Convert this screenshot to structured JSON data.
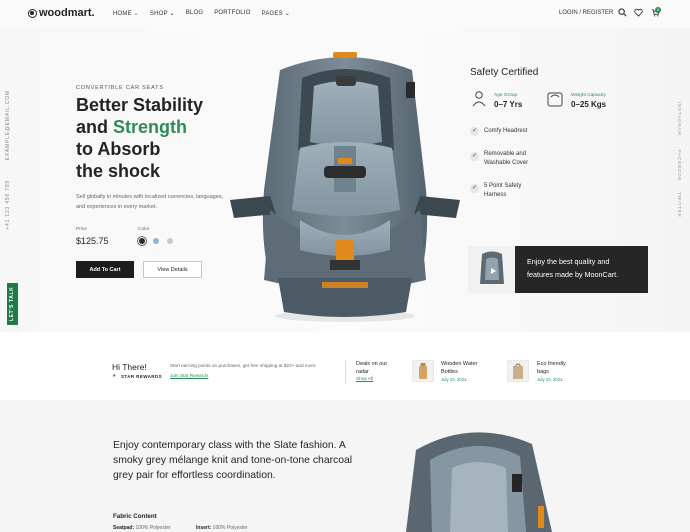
{
  "header": {
    "logo": "woodmart.",
    "nav": [
      {
        "label": "HOME",
        "active": true,
        "dropdown": true
      },
      {
        "label": "SHOP",
        "active": false,
        "dropdown": true
      },
      {
        "label": "BLOG",
        "active": false,
        "dropdown": false
      },
      {
        "label": "PORTFOLIO",
        "active": false,
        "dropdown": false
      },
      {
        "label": "PAGES",
        "active": false,
        "dropdown": true
      }
    ],
    "login": "LOGIN / REGISTER",
    "cart_count": "0",
    "icons": [
      "search-icon",
      "heart-icon",
      "cart-icon"
    ]
  },
  "side": {
    "email": "EXAMPLE@EMAIL.COM",
    "phone": "+41 123 456 789",
    "socials": [
      "INSTAGRAM",
      "FACEBOOK",
      "TWITTER"
    ],
    "lets_talk": "LET'S TALK"
  },
  "hero": {
    "eyebrow": "CONVERTIBLE CAR SEATS",
    "headline_1": "Better Stability",
    "headline_2a": "and",
    "headline_2b": "Strength",
    "headline_3": "to Absorb",
    "headline_4": "the shock",
    "description": "Sell globally in minutes with localized currencies, languages, and experiences in every market.",
    "price_label": "Price",
    "price": "$125.75",
    "color_label": "Color",
    "swatches": [
      "#2b2b2b",
      "#8fb1d6",
      "#c9c9c9"
    ],
    "add_to_cart": "Add To Cart",
    "view_details": "View Details"
  },
  "safety": {
    "title": "Safety Certified",
    "specs": [
      {
        "label": "Age Group",
        "value": "0–7 Yrs",
        "icon": "baby-icon"
      },
      {
        "label": "Weight Capacity",
        "value": "0–25 Kgs",
        "icon": "scale-icon"
      }
    ],
    "features": [
      "Comfy Headrest",
      "Removable and Washable Cover",
      "5 Point Safety Harness"
    ]
  },
  "video": {
    "text": "Enjoy the best quality and features made by MoonCart."
  },
  "promo": {
    "hi": "Hi There!",
    "rewards": "STAR REWARDS",
    "earn": "Start earning points on purchases, get free shipping at $23+ and more.",
    "join": "Join Star Rewards",
    "deals": "Deals on our radar",
    "shop_all": "Shop All",
    "items": [
      {
        "name": "Wooden Water Bottles",
        "date": "July 23, 2023"
      },
      {
        "name": "Eco friendly bags",
        "date": "July 23, 2023"
      }
    ]
  },
  "details": {
    "copy": "Enjoy contemporary class with the Slate fashion. A smoky grey mélange knit and tone-on-tone charcoal grey pair for effortless coordination.",
    "fabric_title": "Fabric Content",
    "seatpad_label": "Seatpad:",
    "seatpad_value": "100% Polyester",
    "insert_label": "Insert:",
    "insert_value": "100% Polyester"
  },
  "colors": {
    "accent": "#2e8b57",
    "dark": "#1c1c1c"
  }
}
